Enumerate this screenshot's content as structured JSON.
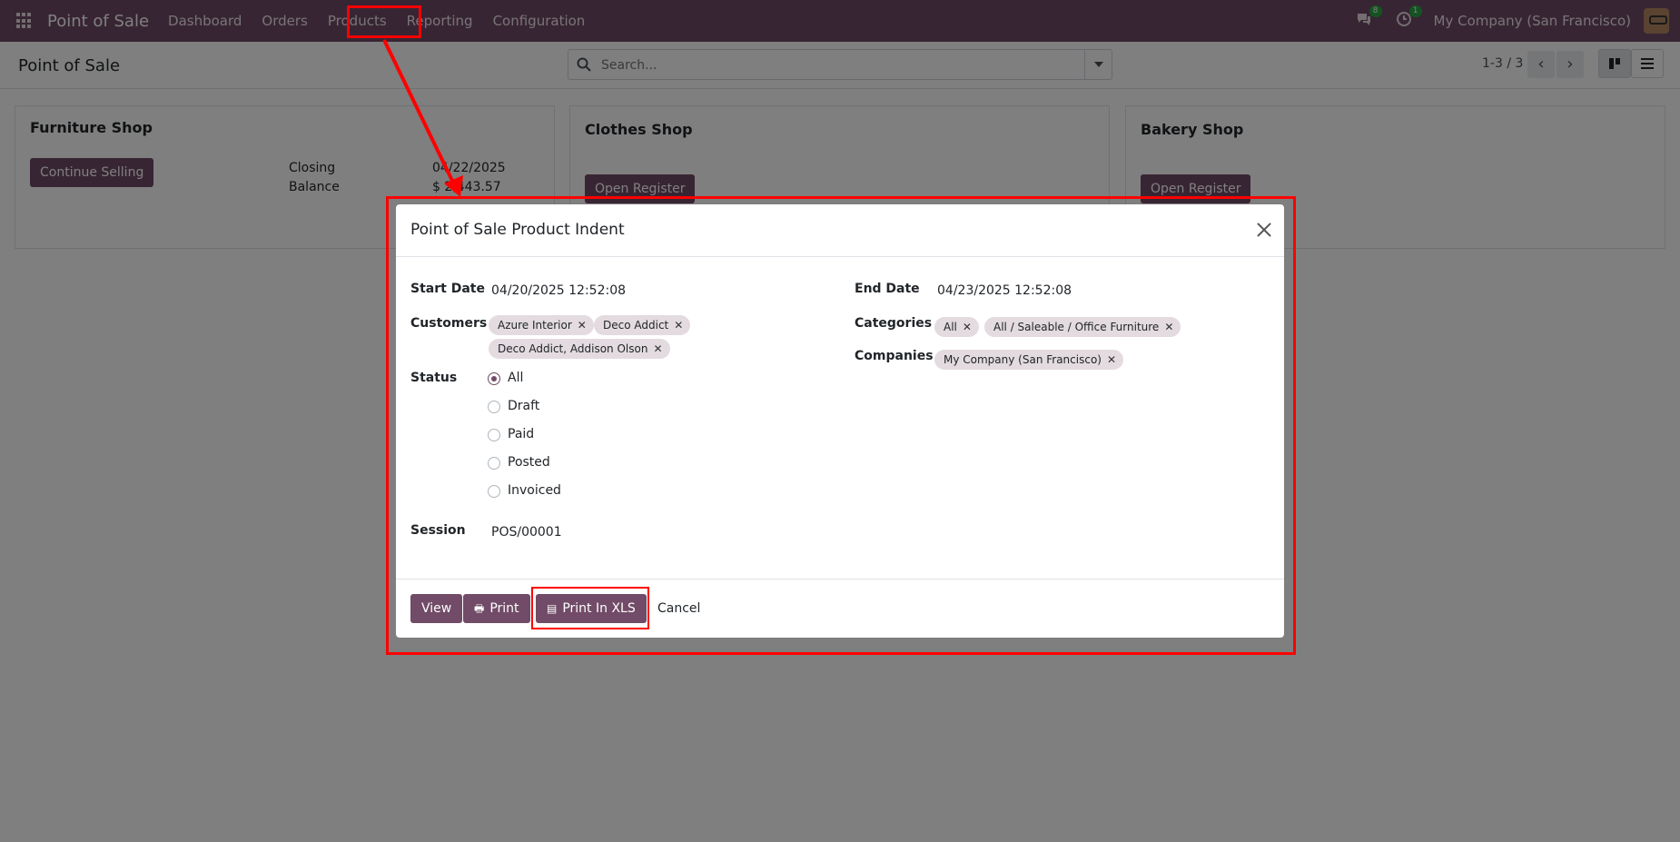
{
  "navbar": {
    "app_name": "Point of Sale",
    "menu": [
      "Dashboard",
      "Orders",
      "Products",
      "Reporting",
      "Configuration"
    ],
    "messages_count": "8",
    "activities_count": "1",
    "company": "My Company (San Francisco)"
  },
  "control_panel": {
    "title": "Point of Sale",
    "search_placeholder": "Search...",
    "pager": "1-3 / 3"
  },
  "cards": [
    {
      "name": "Furniture Shop",
      "button": "Continue Selling",
      "closing_label": "Closing",
      "closing_value": "04/22/2025",
      "balance_label": "Balance",
      "balance_value": "$ 2,443.57"
    },
    {
      "name": "Clothes Shop",
      "button": "Open Register"
    },
    {
      "name": "Bakery Shop",
      "button": "Open Register"
    }
  ],
  "modal": {
    "title": "Point of Sale Product Indent",
    "start_date_label": "Start Date",
    "start_date": "04/20/2025 12:52:08",
    "end_date_label": "End Date",
    "end_date": "04/23/2025 12:52:08",
    "customers_label": "Customers",
    "customers": [
      "Azure Interior",
      "Deco Addict",
      "Deco Addict, Addison Olson"
    ],
    "categories_label": "Categories",
    "categories": [
      "All",
      "All / Saleable / Office Furniture"
    ],
    "companies_label": "Companies",
    "companies": [
      "My Company (San Francisco)"
    ],
    "status_label": "Status",
    "status_options": [
      "All",
      "Draft",
      "Paid",
      "Posted",
      "Invoiced"
    ],
    "status_selected": "All",
    "session_label": "Session",
    "session": "POS/00001",
    "buttons": {
      "view": "View",
      "print": "Print",
      "print_xls": "Print In XLS",
      "cancel": "Cancel"
    }
  },
  "colors": {
    "brand": "#714b67",
    "annotation": "#ff0000"
  }
}
